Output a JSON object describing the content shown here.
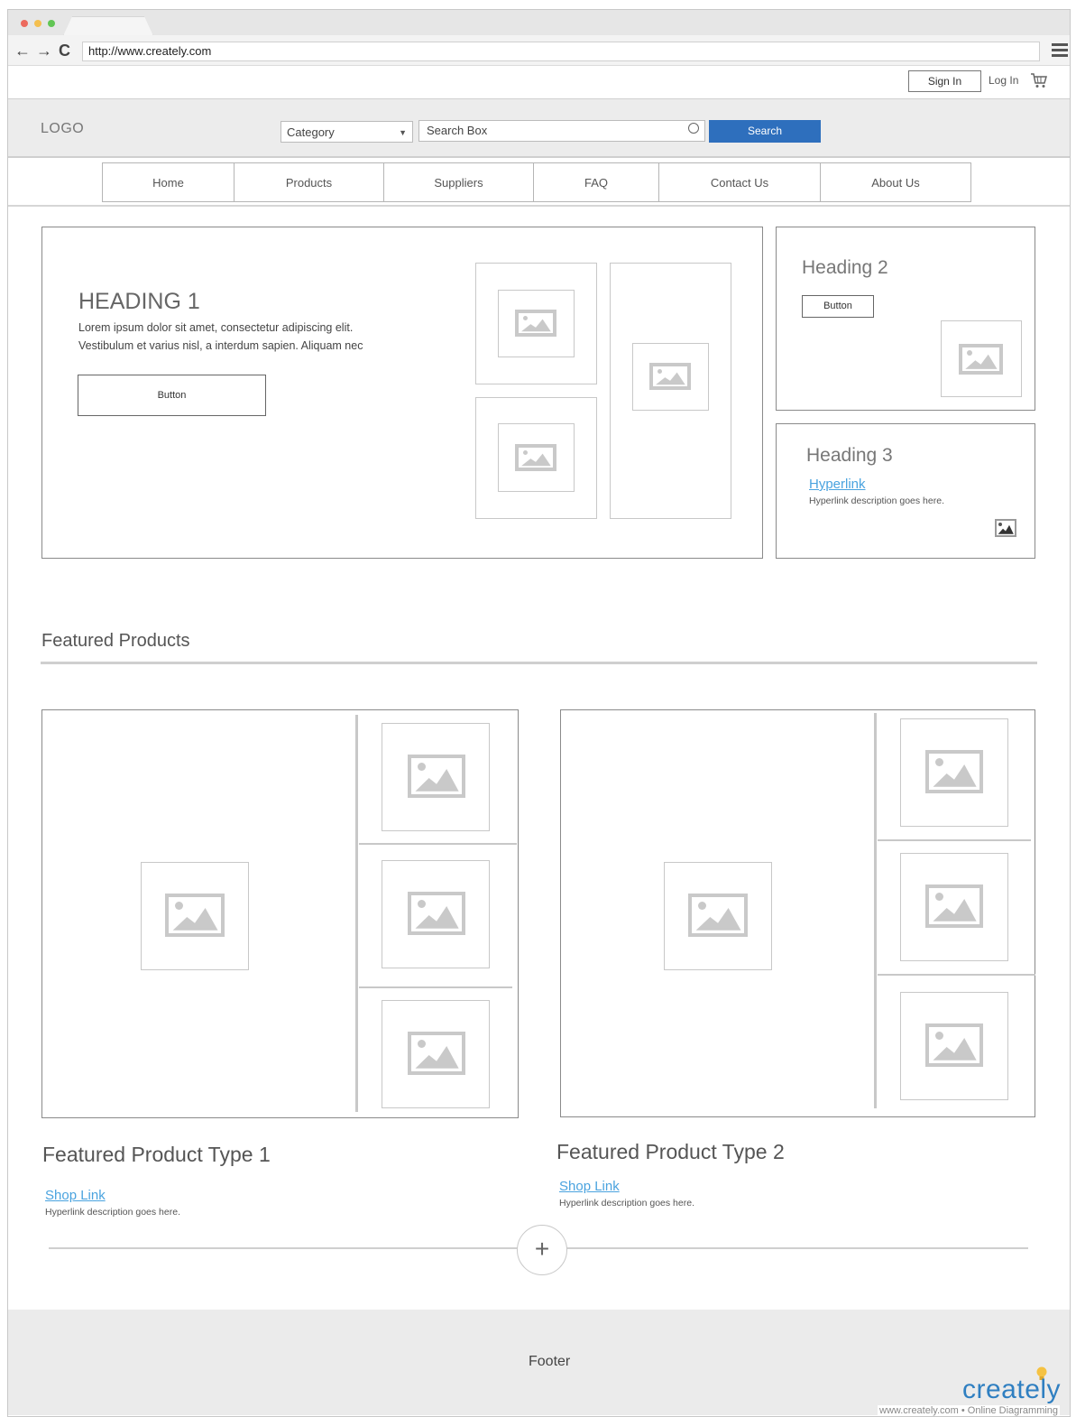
{
  "browser": {
    "url": "http://www.creately.com",
    "dot_colors": [
      "#ec6a5e",
      "#f4bf4f",
      "#61c554"
    ]
  },
  "topbar": {
    "sign_in": "Sign In",
    "log_in": "Log In"
  },
  "header": {
    "logo": "LOGO",
    "category": "Category",
    "search_placeholder": "Search Box",
    "search_button": "Search"
  },
  "menu": [
    "Home",
    "Products",
    "Suppliers",
    "FAQ",
    "Contact Us",
    "About Us"
  ],
  "hero": {
    "heading": "HEADING 1",
    "body_line1": "Lorem ipsum dolor sit amet, consectetur adipiscing elit.",
    "body_line2": "Vestibulum et varius nisl, a interdum sapien. Aliquam nec",
    "button": "Button"
  },
  "side1": {
    "heading": "Heading 2",
    "button": "Button"
  },
  "side2": {
    "heading": "Heading 3",
    "link": "Hyperlink",
    "description": "Hyperlink description goes here."
  },
  "featured": {
    "title": "Featured Products",
    "product1": {
      "title": "Featured Product Type 1",
      "link": "Shop Link",
      "description": "Hyperlink description goes here."
    },
    "product2": {
      "title": "Featured Product Type 2",
      "link": "Shop Link",
      "description": "Hyperlink description goes here."
    },
    "add_symbol": "+"
  },
  "footer": {
    "label": "Footer",
    "brand": "creately",
    "brand_sub": "www.creately.com • Online Diagramming"
  },
  "colors": {
    "accent": "#2e6fbd",
    "link": "#4aa3df"
  },
  "icons": [
    "back-arrow-icon",
    "forward-arrow-icon",
    "refresh-icon",
    "hamburger-menu-icon",
    "cart-icon",
    "search-icon",
    "image-placeholder-icon",
    "plus-icon"
  ]
}
